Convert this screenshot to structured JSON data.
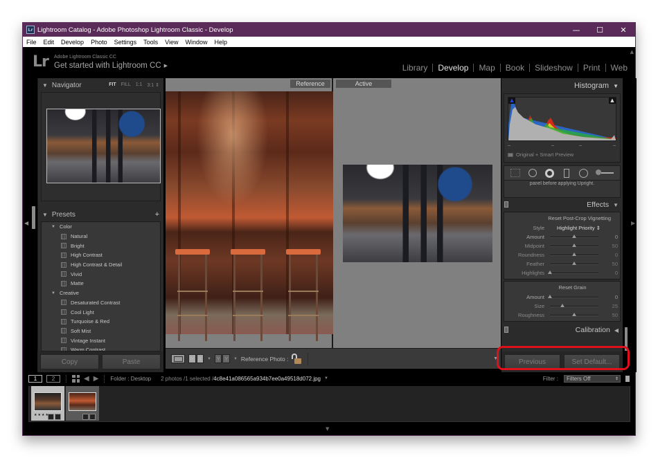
{
  "window": {
    "title": "Lightroom Catalog - Adobe Photoshop Lightroom Classic - Develop",
    "app_icon": "Lr",
    "controls": {
      "minimize": "—",
      "maximize": "☐",
      "close": "✕"
    }
  },
  "menu": [
    "File",
    "Edit",
    "Develop",
    "Photo",
    "Settings",
    "Tools",
    "View",
    "Window",
    "Help"
  ],
  "identity": {
    "logo": "Lr",
    "product": "Adobe Lightroom Classic CC",
    "promo": "Get started with Lightroom CC",
    "promo_arrow": "▶"
  },
  "modules": [
    {
      "label": "Library",
      "active": false
    },
    {
      "label": "Develop",
      "active": true
    },
    {
      "label": "Map",
      "active": false
    },
    {
      "label": "Book",
      "active": false
    },
    {
      "label": "Slideshow",
      "active": false
    },
    {
      "label": "Print",
      "active": false
    },
    {
      "label": "Web",
      "active": false
    }
  ],
  "navigator": {
    "title": "Navigator",
    "zoom_options": [
      "FIT",
      "FILL",
      "1:1",
      "3:1 ⇕"
    ],
    "selected_zoom": "FIT"
  },
  "presets": {
    "title": "Presets",
    "add_icon": "+",
    "groups": [
      {
        "name": "Color",
        "items": [
          "Natural",
          "Bright",
          "High Contrast",
          "High Contrast & Detail",
          "Vivid",
          "Matte"
        ]
      },
      {
        "name": "Creative",
        "items": [
          "Desaturated Contrast",
          "Cool Light",
          "Turquoise & Red",
          "Soft Mist",
          "Vintage Instant",
          "Warm Contrast"
        ]
      }
    ]
  },
  "left_buttons": {
    "copy": "Copy",
    "paste": "Paste"
  },
  "compare": {
    "reference_label": "Reference",
    "active_label": "Active"
  },
  "toolbar": {
    "ra": [
      "R",
      "A"
    ],
    "yy": [
      "Y",
      "Y"
    ],
    "reference_photo_label": "Reference Photo :",
    "dropdown": "▼"
  },
  "histogram": {
    "title": "Histogram",
    "info": "Original + Smart Preview"
  },
  "upright_note": "panel before applying Upright.",
  "effects": {
    "title": "Effects",
    "vignette_reset": "Reset Post-Crop Vignetting",
    "style_label": "Style",
    "style_value": "Highlight Priority ⇕",
    "sliders": [
      {
        "label": "Amount",
        "value": "0",
        "fraction": 0.5,
        "enabled": true
      },
      {
        "label": "Midpoint",
        "value": "50",
        "fraction": 0.5,
        "enabled": false
      },
      {
        "label": "Roundness",
        "value": "0",
        "fraction": 0.5,
        "enabled": false
      },
      {
        "label": "Feather",
        "value": "50",
        "fraction": 0.5,
        "enabled": false
      },
      {
        "label": "Highlights",
        "value": "0",
        "fraction": 0.0,
        "enabled": false
      }
    ],
    "grain_reset": "Reset Grain",
    "grain_sliders": [
      {
        "label": "Amount",
        "value": "0",
        "fraction": 0.0,
        "enabled": true
      },
      {
        "label": "Size",
        "value": "25",
        "fraction": 0.25,
        "enabled": false
      },
      {
        "label": "Roughness",
        "value": "50",
        "fraction": 0.5,
        "enabled": false
      }
    ]
  },
  "calibration": {
    "title": "Calibration"
  },
  "right_buttons": {
    "previous": "Previous",
    "set_default": "Set Default..."
  },
  "filmstrip_bar": {
    "page1": "1",
    "page2": "2",
    "folder": "Folder : Desktop",
    "count": "2 photos /1 selected /",
    "filename": "4c8e41a086565a934b7ee0a49518d072.jpg",
    "filter_label": "Filter :",
    "filter_value": "Filters Off"
  },
  "filmstrip": {
    "thumbnails": [
      {
        "selected": true,
        "rating": "★★★★"
      },
      {
        "selected": false,
        "rating": ""
      }
    ]
  },
  "colors": {
    "titlebar": "#5a2a58",
    "highlight": "#e0101a",
    "panel_bg": "#2b2b2b",
    "canvas_bg": "#808080"
  }
}
